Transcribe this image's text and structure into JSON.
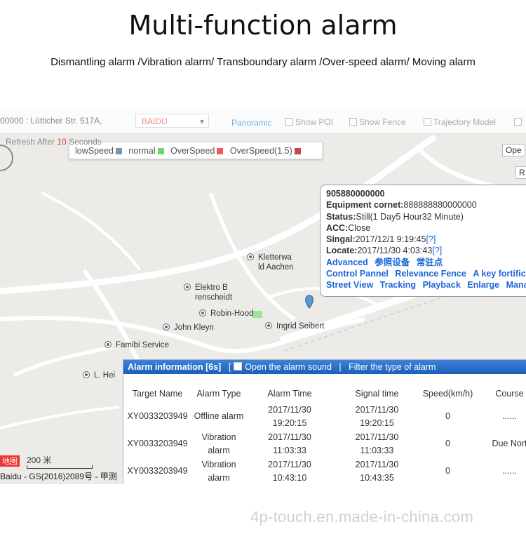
{
  "title": "Multi-function alarm",
  "subtitle": "Dismantling alarm /Vibration alarm/ Transboundary alarm /Over-speed alarm/ Moving alarm",
  "toolbar": {
    "address": "00000 : Lütticher Str. 517A,",
    "map_type": "BAIDU",
    "panoramic": "Panoramic",
    "show_poi": "Show POI",
    "show_fence": "Show Fence",
    "trajectory_model": "Trajectory Model",
    "refresh_prefix": "Refresh After ",
    "refresh_seconds": "10",
    "refresh_suffix": " Seconds",
    "open_btn": "Ope",
    "r_btn": "R"
  },
  "legend": [
    {
      "label": "lowSpeed",
      "color": "#7f92b3"
    },
    {
      "label": "normal",
      "color": "#6cd86a"
    },
    {
      "label": "OverSpeed",
      "color": "#f25a5a"
    },
    {
      "label": "OverSpeed(1.5)",
      "color": "#c44a4a"
    }
  ],
  "pois": [
    "Kletterwa",
    "ld Aachen",
    "Elektro B",
    "renscheidt",
    "Robin-Hood",
    "John Kleyn",
    "Ingrid Seibert",
    "Famibi Service",
    "L. Hei"
  ],
  "popup": {
    "id": "905880000000",
    "equipment_label": "Equipment cornet:",
    "equipment_value": "888888880000000",
    "status_label": "Status:",
    "status_value": "Still(1 Day5 Hour32 Minute)",
    "acc_label": "ACC:",
    "acc_value": "Close",
    "signal_label": "Singal:",
    "signal_value": "2017/12/1 9:19:45",
    "locate_label": "Locate:",
    "locate_value": "2017/11/30 4:03:43",
    "q": "[?]",
    "links_row1": [
      "Advanced",
      "参照设备",
      "常驻点"
    ],
    "links_row2": [
      "Control Pannel",
      "Relevance Fence",
      "A key fortifica"
    ],
    "links_row3": [
      "Street View",
      "Tracking",
      "Playback",
      "Enlarge",
      "Mana"
    ]
  },
  "alarm": {
    "title": "Alarm information [6s]",
    "open_sound": "Open the alarm sound",
    "filter": "Filter the type of alarm",
    "columns": [
      "Target Name",
      "Alarm Type",
      "Alarm Time",
      "Signal time",
      "Speed(km/h)",
      "Course"
    ],
    "rows": [
      {
        "target": "XY0033203949",
        "type": "Offline alarm",
        "alarm_date": "2017/11/30",
        "alarm_clock": "19:20:15",
        "signal_date": "2017/11/30",
        "signal_clock": "19:20:15",
        "speed": "0",
        "course": "......"
      },
      {
        "target": "XY0033203949",
        "type": "Vibration alarm",
        "alarm_date": "2017/11/30",
        "alarm_clock": "11:03:33",
        "signal_date": "2017/11/30",
        "signal_clock": "11:03:33",
        "speed": "0",
        "course": "Due Nort"
      },
      {
        "target": "XY0033203949",
        "type": "Vibration alarm",
        "alarm_date": "2017/11/30",
        "alarm_clock": "10:43:10",
        "signal_date": "2017/11/30",
        "signal_clock": "10:43:35",
        "speed": "0",
        "course": "......"
      }
    ]
  },
  "map_footer": {
    "scale": "200 米",
    "logo": "地图",
    "copyright": "Baidu - GS(2016)2089号 - 甲测"
  },
  "watermark": "4p-touch.en.made-in-china.com"
}
